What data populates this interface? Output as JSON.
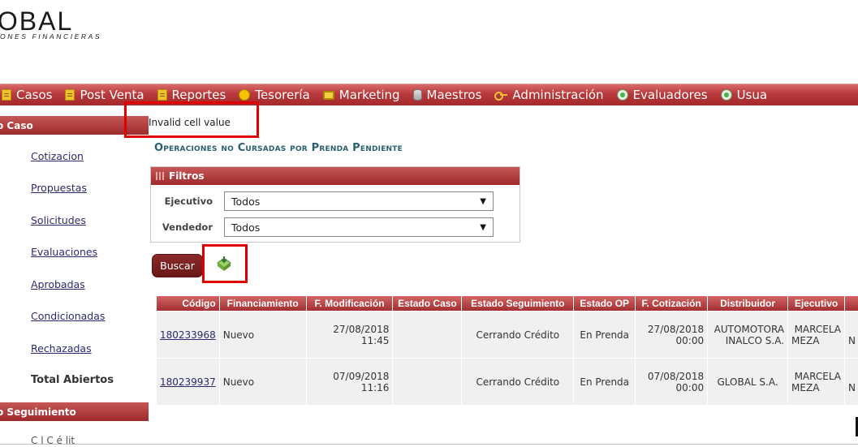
{
  "logo": {
    "main": ".OBAL",
    "sub": "ONES FINANCIERAS"
  },
  "menu": [
    {
      "label": "Casos",
      "icon": "note-icon"
    },
    {
      "label": "Post Venta",
      "icon": "note-icon"
    },
    {
      "label": "Reportes",
      "icon": "note-icon"
    },
    {
      "label": "Tesorería",
      "icon": "coin-icon"
    },
    {
      "label": "Marketing",
      "icon": "monitor-icon"
    },
    {
      "label": "Maestros",
      "icon": "database-icon"
    },
    {
      "label": "Administración",
      "icon": "key-icon"
    },
    {
      "label": "Evaluadores",
      "icon": "evaluator-icon"
    },
    {
      "label": "Usua",
      "icon": "evaluator-icon"
    }
  ],
  "sidebar": {
    "section1": "o Caso",
    "items": [
      "Cotizacion",
      "Propuestas",
      "Solicitudes",
      "Evaluaciones",
      "Aprobadas",
      "Condicionadas",
      "Rechazadas"
    ],
    "total": "Total Abiertos",
    "section2": "o Seguimiento",
    "more": "C     l  C  é  lit"
  },
  "error_message": "Invalid cell value",
  "page_title": "Operaciones no Cursadas por Prenda Pendiente",
  "filters": {
    "title": "Filtros",
    "ejecutivo_label": "Ejecutivo",
    "ejecutivo_value": "Todos",
    "vendedor_label": "Vendedor",
    "vendedor_value": "Todos"
  },
  "buttons": {
    "search": "Buscar",
    "export_icon": "excel-export-icon"
  },
  "table": {
    "headers": [
      "Código",
      "Financiamiento",
      "F. Modificación",
      "Estado Caso",
      "Estado Seguimiento",
      "Estado OP",
      "F. Cotización",
      "Distribuidor",
      "Ejecutivo",
      ""
    ],
    "rows": [
      {
        "codigo": "180233968",
        "financiamiento": "Nuevo",
        "f_mod_date": "27/08/2018",
        "f_mod_time": "11:45",
        "estado_caso": "",
        "estado_seg": "Cerrando Crédito",
        "estado_op": "En Prenda",
        "f_cot_date": "27/08/2018",
        "f_cot_time": "00:00",
        "distribuidor": "AUTOMOTORA INALCO S.A.",
        "ejecutivo_1": "MARCELA",
        "ejecutivo_2": "MEZA",
        "extra": "N"
      },
      {
        "codigo": "180239937",
        "financiamiento": "Nuevo",
        "f_mod_date": "07/09/2018",
        "f_mod_time": "11:16",
        "estado_caso": "",
        "estado_seg": "Cerrando Crédito",
        "estado_op": "En Prenda",
        "f_cot_date": "07/08/2018",
        "f_cot_time": "00:00",
        "distribuidor": "GLOBAL S.A.",
        "ejecutivo_1": "MARCELA",
        "ejecutivo_2": "MEZA",
        "extra": "N"
      }
    ]
  }
}
